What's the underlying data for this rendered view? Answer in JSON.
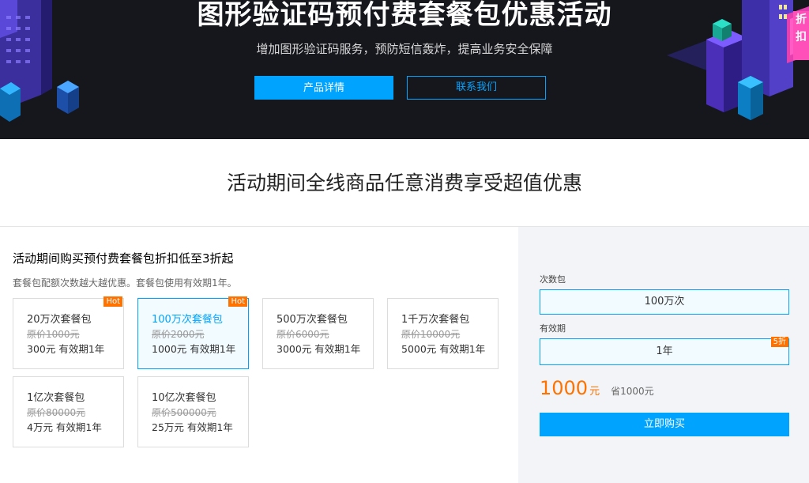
{
  "hero": {
    "title": "图形验证码预付费套餐包优惠活动",
    "subtitle": "增加图形验证码服务，预防短信轰炸，提高业务安全保障",
    "primary_button": "产品详情",
    "secondary_button": "联系我们",
    "badge_text": "折扣"
  },
  "section": {
    "heading": "活动期间全线商品任意消费享受超值优惠"
  },
  "offer": {
    "title": "活动期间购买预付费套餐包折扣低至3折起",
    "description": "套餐包配额次数越大越优惠。套餐包使用有效期1年。",
    "packages": [
      {
        "name": "20万次套餐包",
        "original": "原价1000元",
        "price": "300元 有效期1年",
        "badge": "Hot"
      },
      {
        "name": "100万次套餐包",
        "original": "原价2000元",
        "price": "1000元 有效期1年",
        "badge": "Hot",
        "selected": true
      },
      {
        "name": "500万次套餐包",
        "original": "原价6000元",
        "price": "3000元 有效期1年"
      },
      {
        "name": "1千万次套餐包",
        "original": "原价10000元",
        "price": "5000元 有效期1年"
      },
      {
        "name": "1亿次套餐包",
        "original": "原价80000元",
        "price": "4万元 有效期1年"
      },
      {
        "name": "10亿次套餐包",
        "original": "原价500000元",
        "price": "25万元 有效期1年"
      }
    ]
  },
  "order": {
    "count_label": "次数包",
    "count_value": "100万次",
    "period_label": "有效期",
    "period_value": "1年",
    "period_badge": "5折",
    "price": "1000",
    "price_unit": "元",
    "saving": "省1000元",
    "buy_button": "立即购买"
  },
  "colors": {
    "accent": "#00a4ff",
    "hot": "#ff7200",
    "hero_bg": "#16171d"
  }
}
